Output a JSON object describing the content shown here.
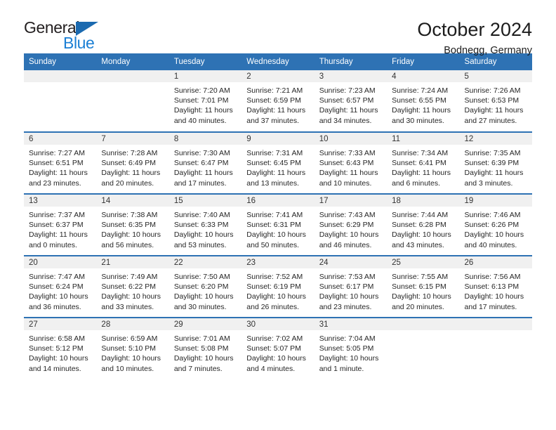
{
  "logo": {
    "word_top": "General",
    "word_bottom": "Blue",
    "triangle_color": "#1b6ab0",
    "top_color": "#231f20",
    "bottom_color": "#1b7fd4"
  },
  "header": {
    "title": "October 2024",
    "subtitle": "Bodnegg, Germany"
  },
  "theme": {
    "header_bg": "#2e72b4",
    "header_text": "#ffffff",
    "daynum_band_bg": "#f0f0f0",
    "row_rule": "#2e72b4"
  },
  "weekday_headers": [
    "Sunday",
    "Monday",
    "Tuesday",
    "Wednesday",
    "Thursday",
    "Friday",
    "Saturday"
  ],
  "weeks": [
    [
      {
        "day": "",
        "sunrise": "",
        "sunset": "",
        "daylight_line1": "",
        "daylight_line2": ""
      },
      {
        "day": "",
        "sunrise": "",
        "sunset": "",
        "daylight_line1": "",
        "daylight_line2": ""
      },
      {
        "day": "1",
        "sunrise": "Sunrise: 7:20 AM",
        "sunset": "Sunset: 7:01 PM",
        "daylight_line1": "Daylight: 11 hours",
        "daylight_line2": "and 40 minutes."
      },
      {
        "day": "2",
        "sunrise": "Sunrise: 7:21 AM",
        "sunset": "Sunset: 6:59 PM",
        "daylight_line1": "Daylight: 11 hours",
        "daylight_line2": "and 37 minutes."
      },
      {
        "day": "3",
        "sunrise": "Sunrise: 7:23 AM",
        "sunset": "Sunset: 6:57 PM",
        "daylight_line1": "Daylight: 11 hours",
        "daylight_line2": "and 34 minutes."
      },
      {
        "day": "4",
        "sunrise": "Sunrise: 7:24 AM",
        "sunset": "Sunset: 6:55 PM",
        "daylight_line1": "Daylight: 11 hours",
        "daylight_line2": "and 30 minutes."
      },
      {
        "day": "5",
        "sunrise": "Sunrise: 7:26 AM",
        "sunset": "Sunset: 6:53 PM",
        "daylight_line1": "Daylight: 11 hours",
        "daylight_line2": "and 27 minutes."
      }
    ],
    [
      {
        "day": "6",
        "sunrise": "Sunrise: 7:27 AM",
        "sunset": "Sunset: 6:51 PM",
        "daylight_line1": "Daylight: 11 hours",
        "daylight_line2": "and 23 minutes."
      },
      {
        "day": "7",
        "sunrise": "Sunrise: 7:28 AM",
        "sunset": "Sunset: 6:49 PM",
        "daylight_line1": "Daylight: 11 hours",
        "daylight_line2": "and 20 minutes."
      },
      {
        "day": "8",
        "sunrise": "Sunrise: 7:30 AM",
        "sunset": "Sunset: 6:47 PM",
        "daylight_line1": "Daylight: 11 hours",
        "daylight_line2": "and 17 minutes."
      },
      {
        "day": "9",
        "sunrise": "Sunrise: 7:31 AM",
        "sunset": "Sunset: 6:45 PM",
        "daylight_line1": "Daylight: 11 hours",
        "daylight_line2": "and 13 minutes."
      },
      {
        "day": "10",
        "sunrise": "Sunrise: 7:33 AM",
        "sunset": "Sunset: 6:43 PM",
        "daylight_line1": "Daylight: 11 hours",
        "daylight_line2": "and 10 minutes."
      },
      {
        "day": "11",
        "sunrise": "Sunrise: 7:34 AM",
        "sunset": "Sunset: 6:41 PM",
        "daylight_line1": "Daylight: 11 hours",
        "daylight_line2": "and 6 minutes."
      },
      {
        "day": "12",
        "sunrise": "Sunrise: 7:35 AM",
        "sunset": "Sunset: 6:39 PM",
        "daylight_line1": "Daylight: 11 hours",
        "daylight_line2": "and 3 minutes."
      }
    ],
    [
      {
        "day": "13",
        "sunrise": "Sunrise: 7:37 AM",
        "sunset": "Sunset: 6:37 PM",
        "daylight_line1": "Daylight: 11 hours",
        "daylight_line2": "and 0 minutes."
      },
      {
        "day": "14",
        "sunrise": "Sunrise: 7:38 AM",
        "sunset": "Sunset: 6:35 PM",
        "daylight_line1": "Daylight: 10 hours",
        "daylight_line2": "and 56 minutes."
      },
      {
        "day": "15",
        "sunrise": "Sunrise: 7:40 AM",
        "sunset": "Sunset: 6:33 PM",
        "daylight_line1": "Daylight: 10 hours",
        "daylight_line2": "and 53 minutes."
      },
      {
        "day": "16",
        "sunrise": "Sunrise: 7:41 AM",
        "sunset": "Sunset: 6:31 PM",
        "daylight_line1": "Daylight: 10 hours",
        "daylight_line2": "and 50 minutes."
      },
      {
        "day": "17",
        "sunrise": "Sunrise: 7:43 AM",
        "sunset": "Sunset: 6:29 PM",
        "daylight_line1": "Daylight: 10 hours",
        "daylight_line2": "and 46 minutes."
      },
      {
        "day": "18",
        "sunrise": "Sunrise: 7:44 AM",
        "sunset": "Sunset: 6:28 PM",
        "daylight_line1": "Daylight: 10 hours",
        "daylight_line2": "and 43 minutes."
      },
      {
        "day": "19",
        "sunrise": "Sunrise: 7:46 AM",
        "sunset": "Sunset: 6:26 PM",
        "daylight_line1": "Daylight: 10 hours",
        "daylight_line2": "and 40 minutes."
      }
    ],
    [
      {
        "day": "20",
        "sunrise": "Sunrise: 7:47 AM",
        "sunset": "Sunset: 6:24 PM",
        "daylight_line1": "Daylight: 10 hours",
        "daylight_line2": "and 36 minutes."
      },
      {
        "day": "21",
        "sunrise": "Sunrise: 7:49 AM",
        "sunset": "Sunset: 6:22 PM",
        "daylight_line1": "Daylight: 10 hours",
        "daylight_line2": "and 33 minutes."
      },
      {
        "day": "22",
        "sunrise": "Sunrise: 7:50 AM",
        "sunset": "Sunset: 6:20 PM",
        "daylight_line1": "Daylight: 10 hours",
        "daylight_line2": "and 30 minutes."
      },
      {
        "day": "23",
        "sunrise": "Sunrise: 7:52 AM",
        "sunset": "Sunset: 6:19 PM",
        "daylight_line1": "Daylight: 10 hours",
        "daylight_line2": "and 26 minutes."
      },
      {
        "day": "24",
        "sunrise": "Sunrise: 7:53 AM",
        "sunset": "Sunset: 6:17 PM",
        "daylight_line1": "Daylight: 10 hours",
        "daylight_line2": "and 23 minutes."
      },
      {
        "day": "25",
        "sunrise": "Sunrise: 7:55 AM",
        "sunset": "Sunset: 6:15 PM",
        "daylight_line1": "Daylight: 10 hours",
        "daylight_line2": "and 20 minutes."
      },
      {
        "day": "26",
        "sunrise": "Sunrise: 7:56 AM",
        "sunset": "Sunset: 6:13 PM",
        "daylight_line1": "Daylight: 10 hours",
        "daylight_line2": "and 17 minutes."
      }
    ],
    [
      {
        "day": "27",
        "sunrise": "Sunrise: 6:58 AM",
        "sunset": "Sunset: 5:12 PM",
        "daylight_line1": "Daylight: 10 hours",
        "daylight_line2": "and 14 minutes."
      },
      {
        "day": "28",
        "sunrise": "Sunrise: 6:59 AM",
        "sunset": "Sunset: 5:10 PM",
        "daylight_line1": "Daylight: 10 hours",
        "daylight_line2": "and 10 minutes."
      },
      {
        "day": "29",
        "sunrise": "Sunrise: 7:01 AM",
        "sunset": "Sunset: 5:08 PM",
        "daylight_line1": "Daylight: 10 hours",
        "daylight_line2": "and 7 minutes."
      },
      {
        "day": "30",
        "sunrise": "Sunrise: 7:02 AM",
        "sunset": "Sunset: 5:07 PM",
        "daylight_line1": "Daylight: 10 hours",
        "daylight_line2": "and 4 minutes."
      },
      {
        "day": "31",
        "sunrise": "Sunrise: 7:04 AM",
        "sunset": "Sunset: 5:05 PM",
        "daylight_line1": "Daylight: 10 hours",
        "daylight_line2": "and 1 minute."
      },
      {
        "day": "",
        "sunrise": "",
        "sunset": "",
        "daylight_line1": "",
        "daylight_line2": ""
      },
      {
        "day": "",
        "sunrise": "",
        "sunset": "",
        "daylight_line1": "",
        "daylight_line2": ""
      }
    ]
  ]
}
